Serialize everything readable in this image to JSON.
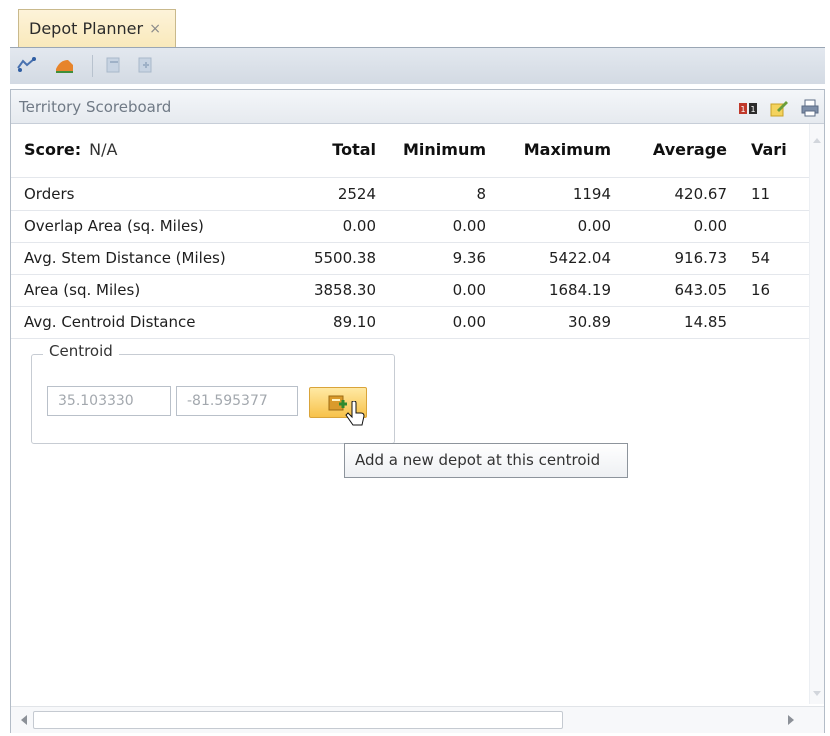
{
  "tab": {
    "label": "Depot Planner",
    "close": "×"
  },
  "toolbar": {
    "icons": [
      "route-icon",
      "layer-icon",
      "copy-icon",
      "paste-icon"
    ]
  },
  "panel": {
    "title": "Territory Scoreboard",
    "icons": [
      "compare-icon",
      "edit-icon",
      "print-icon"
    ]
  },
  "table": {
    "score_label": "Score:",
    "score_value": "N/A",
    "headers": [
      "Total",
      "Minimum",
      "Maximum",
      "Average",
      "Vari"
    ],
    "rows": [
      {
        "label": "Orders",
        "total": "2524",
        "min": "8",
        "max": "1194",
        "avg": "420.67",
        "var": "11"
      },
      {
        "label": "Overlap Area (sq. Miles)",
        "total": "0.00",
        "min": "0.00",
        "max": "0.00",
        "avg": "0.00",
        "var": ""
      },
      {
        "label": "Avg. Stem Distance (Miles)",
        "total": "5500.38",
        "min": "9.36",
        "max": "5422.04",
        "avg": "916.73",
        "var": "54"
      },
      {
        "label": "Area (sq. Miles)",
        "total": "3858.30",
        "min": "0.00",
        "max": "1684.19",
        "avg": "643.05",
        "var": "16"
      },
      {
        "label": "Avg. Centroid Distance",
        "total": "89.10",
        "min": "0.00",
        "max": "30.89",
        "avg": "14.85",
        "var": ""
      }
    ]
  },
  "centroid": {
    "title": "Centroid",
    "lat": "35.103330",
    "lon": "-81.595377",
    "add_tooltip": "Add a new depot at this centroid"
  },
  "colors": {
    "tab_bg": "#f9e9bb",
    "button_bg": "#f7c24a",
    "toolbar_bg": "#d3dae3"
  }
}
